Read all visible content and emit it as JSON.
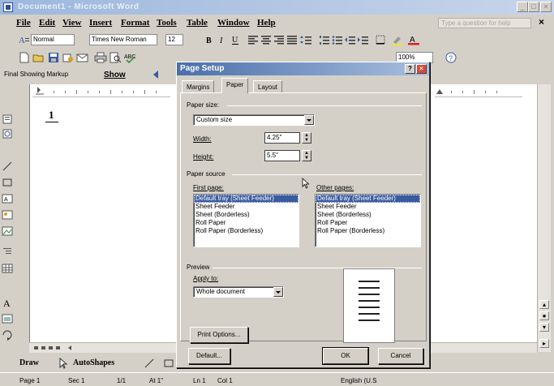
{
  "app": {
    "title": "Document1 - Microsoft Word",
    "help_placeholder": "Type a question for help"
  },
  "menu": [
    "File",
    "Edit",
    "View",
    "Insert",
    "Format",
    "Tools",
    "Table",
    "Window",
    "Help"
  ],
  "formatting_toolbar": {
    "style": "Normal",
    "font": "Times New Roman",
    "size": "12"
  },
  "standard_toolbar": {
    "zoom": "100%"
  },
  "review_toolbar": {
    "display": "Final Showing Markup",
    "show_label": "Show"
  },
  "document": {
    "page_number": "1"
  },
  "drawing_toolbar": {
    "draw_label": "Draw",
    "autoshapes_label": "AutoShapes"
  },
  "statusbar": {
    "page": "Page 1",
    "section": "Sec 1",
    "page_of": "1/1",
    "at": "At 1\"",
    "line": "Ln 1",
    "col": "Col 1",
    "language": "English (U.S"
  },
  "dialog": {
    "title": "Page Setup",
    "tabs": [
      "Margins",
      "Paper",
      "Layout"
    ],
    "active_tab": "Paper",
    "paper_size": {
      "label": "Paper size:",
      "value": "Custom size",
      "width_label": "Width:",
      "width_value": "4.25\"",
      "height_label": "Height:",
      "height_value": "5.5\""
    },
    "paper_source": {
      "label": "Paper source",
      "first_page_label": "First page:",
      "other_pages_label": "Other pages:",
      "first_page_items": [
        "Default tray (Sheet Feeder)",
        "Sheet Feeder",
        "Sheet (Borderless)",
        "Roll Paper",
        "Roll Paper (Borderless)"
      ],
      "other_pages_items": [
        "Default tray (Sheet Feeder)",
        "Sheet Feeder",
        "Sheet (Borderless)",
        "Roll Paper",
        "Roll Paper (Borderless)"
      ],
      "selected_first": "Default tray (Sheet Feeder)",
      "selected_other": "Default tray (Sheet Feeder)"
    },
    "preview": {
      "label": "Preview",
      "apply_to_label": "Apply to:",
      "apply_to_value": "Whole document"
    },
    "buttons": {
      "print_options": "Print Options...",
      "default": "Default...",
      "ok": "OK",
      "cancel": "Cancel"
    }
  }
}
